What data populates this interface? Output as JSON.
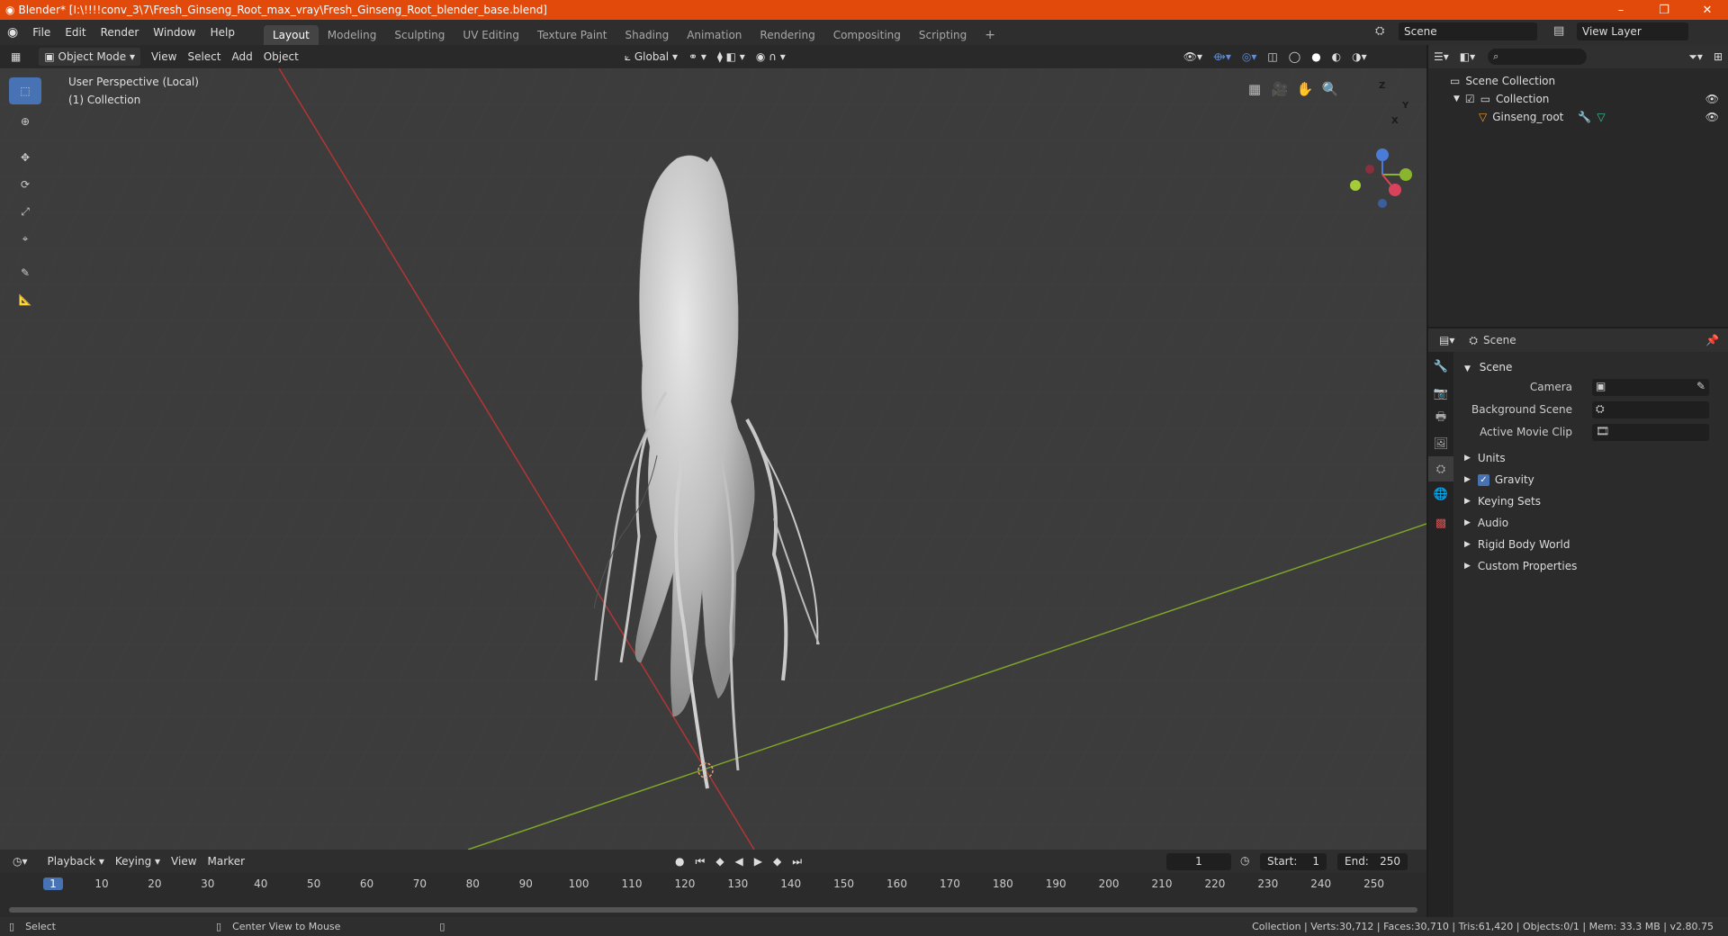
{
  "window": {
    "title": "Blender* [I:\\!!!!conv_3\\7\\Fresh_Ginseng_Root_max_vray\\Fresh_Ginseng_Root_blender_base.blend]",
    "minimize": "–",
    "maximize": "❐",
    "close": "✕"
  },
  "menu": {
    "items": [
      "File",
      "Edit",
      "Render",
      "Window",
      "Help"
    ]
  },
  "workspaces": [
    "Layout",
    "Modeling",
    "Sculpting",
    "UV Editing",
    "Texture Paint",
    "Shading",
    "Animation",
    "Rendering",
    "Compositing",
    "Scripting"
  ],
  "add_workspace": "+",
  "scene_selector": {
    "value": "Scene"
  },
  "view_layer": {
    "value": "View Layer"
  },
  "viewport_header": {
    "mode": "Object Mode",
    "menus": [
      "View",
      "Select",
      "Add",
      "Object"
    ],
    "transform_orientation": "Global"
  },
  "viewport": {
    "perspective": "User Perspective (Local)",
    "collection": "(1) Collection",
    "gizmo": {
      "z": "Z",
      "y": "Y",
      "x": "X"
    }
  },
  "outliner": {
    "root": "Scene Collection",
    "collection": "Collection",
    "object": "Ginseng_root"
  },
  "properties": {
    "header_title": "Scene",
    "panel_title": "Scene",
    "fields": {
      "camera_label": "Camera",
      "background_label": "Background Scene",
      "movie_clip_label": "Active Movie Clip"
    },
    "subpanels": [
      "Units",
      "Gravity",
      "Keying Sets",
      "Audio",
      "Rigid Body World",
      "Custom Properties"
    ]
  },
  "timeline": {
    "menus": [
      "Playback",
      "Keying",
      "View",
      "Marker"
    ],
    "current_frame": "1",
    "start_label": "Start:",
    "start_value": "1",
    "end_label": "End:",
    "end_value": "250",
    "ruler": [
      "1",
      "10",
      "20",
      "30",
      "40",
      "50",
      "60",
      "70",
      "80",
      "90",
      "100",
      "110",
      "120",
      "130",
      "140",
      "150",
      "160",
      "170",
      "180",
      "190",
      "200",
      "210",
      "220",
      "230",
      "240",
      "250"
    ]
  },
  "statusbar": {
    "select": "Select",
    "center_view": "Center View to Mouse",
    "stats": "Collection | Verts:30,712 | Faces:30,710 | Tris:61,420 | Objects:0/1 | Mem: 33.3 MB | v2.80.75"
  },
  "colors": {
    "accent": "#4772b3",
    "titlebar": "#e24a0c",
    "x_axis": "#c0393b",
    "y_axis": "#7fa52a"
  }
}
